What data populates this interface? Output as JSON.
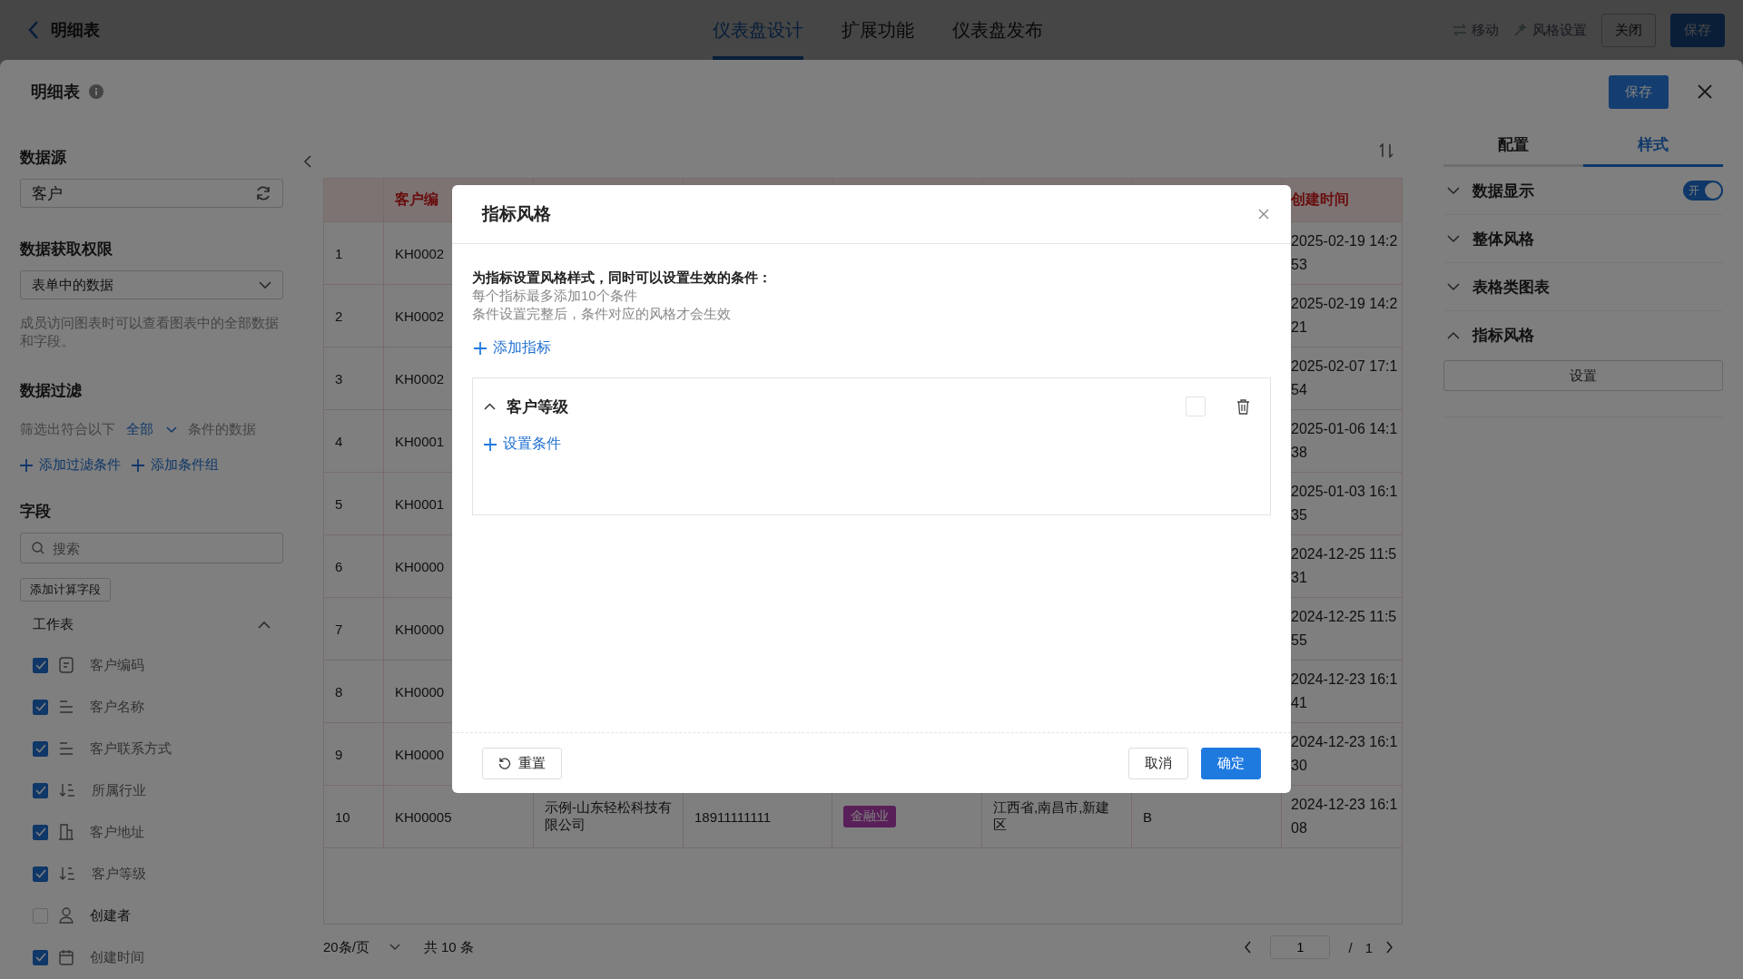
{
  "topbar": {
    "title": "明细表",
    "tabs": [
      {
        "label": "仪表盘设计",
        "selected": true
      },
      {
        "label": "扩展功能",
        "selected": false
      },
      {
        "label": "仪表盘发布",
        "selected": false
      }
    ],
    "actions": [
      {
        "kind": "move",
        "label": "移动"
      },
      {
        "kind": "style",
        "label": "风格设置"
      },
      {
        "kind": "plain",
        "label": "关闭"
      },
      {
        "kind": "primary",
        "label": "保存"
      }
    ]
  },
  "sheet": {
    "title": "明细表",
    "save": "保存"
  },
  "left": {
    "source_label": "数据源",
    "source_value": "客户",
    "permission_label": "数据获取权限",
    "permission_value": "表单中的数据",
    "permission_hint": "成员访问图表时可以查看图表中的全部数据和字段。",
    "filter_label": "数据过滤",
    "filter_prefix": "筛选出符合以下",
    "filter_mode": "全部",
    "filter_suffix": "条件的数据",
    "filter_links": [
      "添加过滤条件",
      "添加条件组"
    ],
    "fields_label": "字段",
    "search_placeholder": "搜索",
    "calc_button": "添加计算字段",
    "group": {
      "label": "工作表",
      "expanded": true
    },
    "fields": [
      {
        "kind": "serial",
        "label": "客户编码",
        "checked": true
      },
      {
        "kind": "text",
        "label": "客户名称",
        "checked": true
      },
      {
        "kind": "text",
        "label": "客户联系方式",
        "checked": true
      },
      {
        "kind": "select",
        "label": "所属行业",
        "checked": true
      },
      {
        "kind": "address",
        "label": "客户地址",
        "checked": true
      },
      {
        "kind": "select",
        "label": "客户等级",
        "checked": true
      },
      {
        "kind": "user",
        "label": "创建者",
        "checked": false
      },
      {
        "kind": "date",
        "label": "创建时间",
        "checked": true
      }
    ]
  },
  "table": {
    "columns": [
      "",
      "客户编",
      "",
      "",
      "",
      "",
      "",
      "创建时间"
    ],
    "rows": [
      {
        "index": "1",
        "code": "KH0002",
        "created": [
          "2025-02-19 14:2",
          "53"
        ]
      },
      {
        "index": "2",
        "code": "KH0002",
        "created": [
          "2025-02-19 14:2",
          "21"
        ]
      },
      {
        "index": "3",
        "code": "KH0002",
        "created": [
          "2025-02-07 17:1",
          "54"
        ]
      },
      {
        "index": "4",
        "code": "KH0001",
        "created": [
          "2025-01-06 14:1",
          "38"
        ]
      },
      {
        "index": "5",
        "code": "KH0001",
        "created": [
          "2025-01-03 16:1",
          "35"
        ]
      },
      {
        "index": "6",
        "code": "KH0000",
        "created": [
          "2024-12-25 11:5",
          "31"
        ]
      },
      {
        "index": "7",
        "code": "KH0000",
        "created": [
          "2024-12-25 11:5",
          "55"
        ]
      },
      {
        "index": "8",
        "code": "KH0000",
        "created": [
          "2024-12-23 16:1",
          "41"
        ]
      },
      {
        "index": "9",
        "code": "KH0000",
        "created": [
          "2024-12-23 16:1",
          "30"
        ]
      },
      {
        "index": "10",
        "code": "KH00005",
        "name": "示例-山东轻松科技有限公司",
        "phone": "18911111111",
        "industry": "金融业",
        "address": "江西省,南昌市,新建区",
        "level": "B",
        "created": [
          "2024-12-23 16:1",
          "08"
        ]
      }
    ]
  },
  "pagination": {
    "page_size": "20条/页",
    "total": "共 10 条",
    "page": "1",
    "separator": "/",
    "pages": "1"
  },
  "right": {
    "tabs": [
      {
        "label": "配置",
        "selected": false
      },
      {
        "label": "样式",
        "selected": true
      }
    ],
    "sections": [
      {
        "label": "数据显示",
        "expanded": false,
        "toggle": {
          "on": true,
          "label": "开"
        }
      },
      {
        "label": "整体风格",
        "expanded": false
      },
      {
        "label": "表格类图表",
        "expanded": false
      },
      {
        "label": "指标风格",
        "expanded": true,
        "button": "设置"
      }
    ]
  },
  "modal": {
    "title": "指标风格",
    "intro": "为指标设置风格样式，同时可以设置生效的条件：",
    "notes": [
      "每个指标最多添加10个条件",
      "条件设置完整后，条件对应的风格才会生效"
    ],
    "add_link": "添加指标",
    "indicators": [
      {
        "label": "客户等级",
        "expanded": true,
        "color": "#ffffff",
        "add_condition": "设置条件"
      }
    ],
    "reset": "重置",
    "cancel": "取消",
    "confirm": "确定"
  }
}
